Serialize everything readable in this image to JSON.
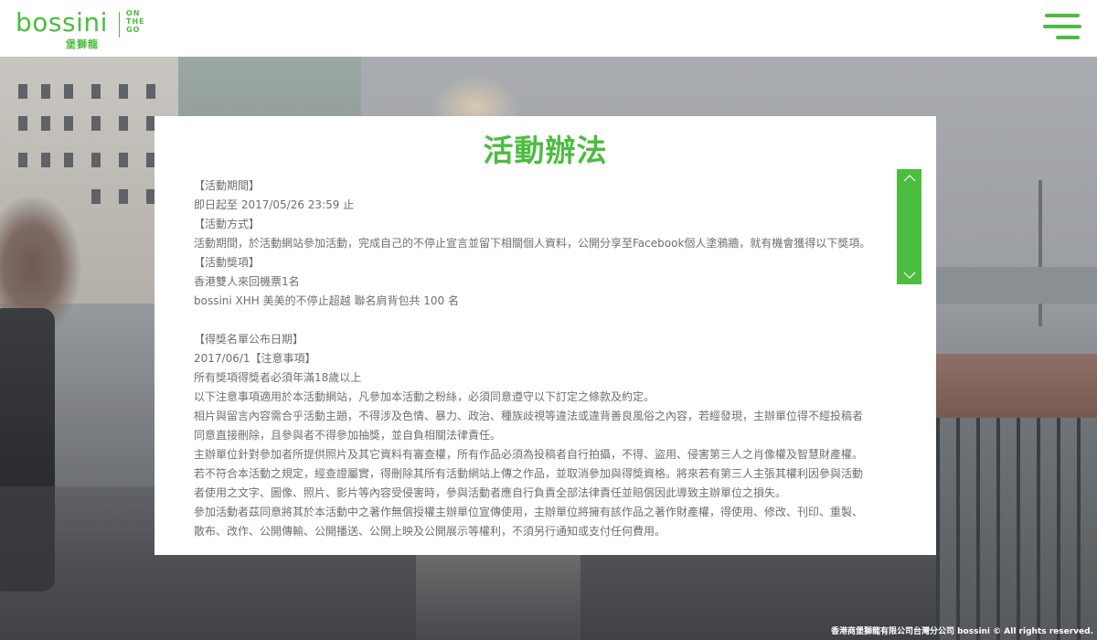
{
  "header": {
    "logo_text": "bossini",
    "logo_chinese": "堡獅龍",
    "logo_tagline": [
      "ON",
      "THE",
      "GO"
    ],
    "menu_icon": "hamburger-menu-icon"
  },
  "modal": {
    "title": "活動辦法",
    "lines": [
      "【活動期間】",
      "即日起至 2017/05/26 23:59 止",
      "【活動方式】",
      "活動期間，於活動網站參加活動，完成自己的不停止宣言並留下相關個人資料，公開分享至Facebook個人塗鴉牆，就有機會獲得以下獎項。",
      "【活動獎項】",
      "香港雙人來回機票1名",
      "bossini XHH 美美的不停止超越 聯名肩背包共 100 名",
      "",
      "【得獎名單公布日期】",
      "2017/06/1【注意事項】",
      "所有獎項得獎者必須年滿18歲以上",
      "以下注意事項適用於本活動網站，凡參加本活動之粉絲，必須同意遵守以下訂定之條款及約定。",
      "相片與留言內容需合乎活動主題，不得涉及色情、暴力、政治、種族歧視等違法或違背善良風俗之內容，若經發現，主辦單位得不經投稿者",
      "同意直接刪除，且參與者不得參加抽獎，並自負相關法律責任。",
      "主辦單位針對參加者所提供照片及其它資料有審查權，所有作品必須為投稿者自行拍攝，不得、盜用、侵害第三人之肖像權及智慧財產權。",
      "若不符合本活動之規定，經查證屬實，得刪除其所有活動網站上傳之作品，並取消參加與得獎資格。將來若有第三人主張其權利因參與活動",
      "者使用之文字、圖像、照片、影片等內容受侵害時，參與活動者應自行負責全部法律責任並賠償因此導致主辦單位之損失。",
      "參加活動者茲同意將其於本活動中之著作無償授權主辦單位宣傳使用，主辦單位將擁有該作品之著作財產權，得使用、修改、刊印、重製、",
      "散布、改作、公開傳輸、公開播送、公開上映及公開展示等權利，不須另行通知或支付任何費用。"
    ]
  },
  "scrollbar": {
    "up_icon": "chevron-up-icon",
    "down_icon": "chevron-down-icon"
  },
  "footer": {
    "copyright": "香港商堡獅龍有限公司台灣分公司 bossini © All rights reserved."
  },
  "colors": {
    "brand_green": "#4bbd3f",
    "body_text": "#6f6f6f"
  }
}
